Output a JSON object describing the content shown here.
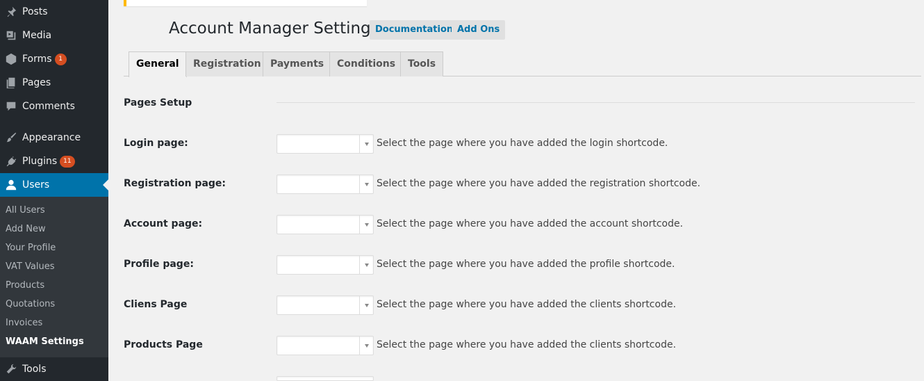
{
  "sidebar": {
    "items": [
      {
        "label": "Posts",
        "icon": "pushpin-icon"
      },
      {
        "label": "Media",
        "icon": "media-icon"
      },
      {
        "label": "Forms",
        "icon": "forms-icon",
        "badge": "1"
      },
      {
        "label": "Pages",
        "icon": "pages-icon"
      },
      {
        "label": "Comments",
        "icon": "comments-icon"
      },
      {
        "label": "Appearance",
        "icon": "paintbrush-icon"
      },
      {
        "label": "Plugins",
        "icon": "plugins-icon",
        "badge": "11"
      },
      {
        "label": "Users",
        "icon": "users-icon"
      },
      {
        "label": "Tools",
        "icon": "tools-icon"
      }
    ],
    "submenu": [
      "All Users",
      "Add New",
      "Your Profile",
      "VAT Values",
      "Products",
      "Quotations",
      "Invoices",
      "WAAM Settings"
    ]
  },
  "header": {
    "title": "Account Manager Settings",
    "documentation_label": "Documentation",
    "addons_label": "Add Ons"
  },
  "tabs": [
    "General",
    "Registration",
    "Payments",
    "Conditions",
    "Tools"
  ],
  "section": {
    "title": "Pages Setup"
  },
  "rows": [
    {
      "label": "Login page:",
      "desc": "Select the page where you have added the login shortcode."
    },
    {
      "label": "Registration page:",
      "desc": "Select the page where you have added the registration shortcode."
    },
    {
      "label": "Account page:",
      "desc": "Select the page where you have added the account shortcode."
    },
    {
      "label": "Profile page:",
      "desc": "Select the page where you have added the profile shortcode."
    },
    {
      "label": "Cliens Page",
      "desc": "Select the page where you have added the clients shortcode."
    },
    {
      "label": "Products Page",
      "desc": "Select the page where you have added the clients shortcode."
    }
  ],
  "colors": {
    "sidebar_bg": "#23282d",
    "submenu_bg": "#32373c",
    "accent": "#0073aa",
    "badge": "#d54e21",
    "notice": "#ffb900"
  }
}
